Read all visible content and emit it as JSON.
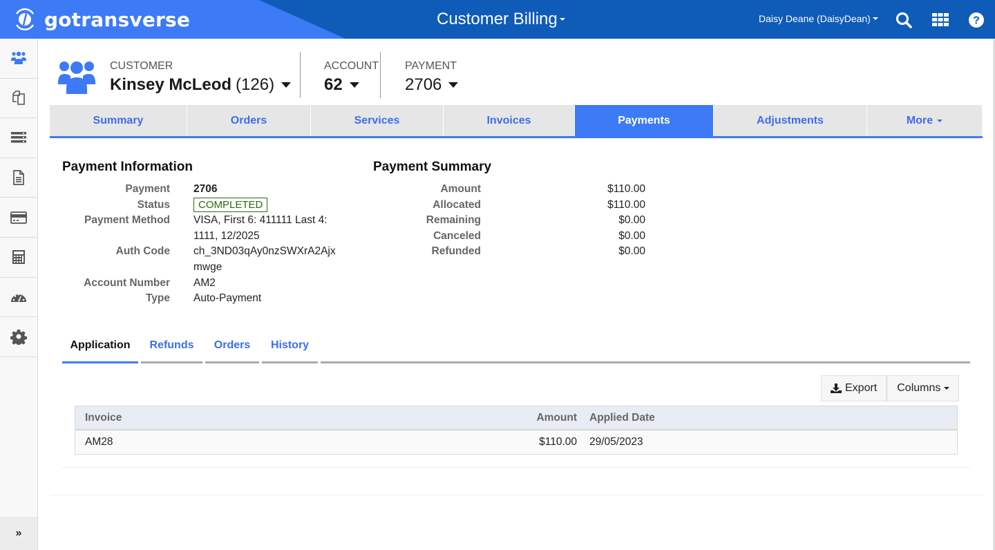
{
  "topbar": {
    "brand": "gotransverse",
    "app_title": "Customer Billing",
    "user": "Daisy Deane (DaisyDean)",
    "icons": [
      "search-icon",
      "apps-grid-icon",
      "help-icon"
    ],
    "colors": {
      "bar": "#0f5bb8",
      "brand_bg": "#3d7af5"
    }
  },
  "sidebar": {
    "items": [
      {
        "icon": "customers-icon",
        "active": true
      },
      {
        "icon": "documents-icon",
        "active": false
      },
      {
        "icon": "services-list-icon",
        "active": false
      },
      {
        "icon": "invoice-icon",
        "active": false
      },
      {
        "icon": "credit-card-icon",
        "active": false
      },
      {
        "icon": "calculator-icon",
        "active": false
      },
      {
        "icon": "dashboard-gauge-icon",
        "active": false
      },
      {
        "icon": "settings-gear-icon",
        "active": false
      }
    ],
    "expand_label": "»"
  },
  "context": {
    "customer_label": "CUSTOMER",
    "customer_name": "Kinsey McLeod",
    "customer_id": "(126)",
    "account_label": "ACCOUNT",
    "account_value": "62",
    "payment_label": "PAYMENT",
    "payment_value": "2706"
  },
  "main_tabs": [
    {
      "label": "Summary",
      "active": false
    },
    {
      "label": "Orders",
      "active": false
    },
    {
      "label": "Services",
      "active": false
    },
    {
      "label": "Invoices",
      "active": false
    },
    {
      "label": "Payments",
      "active": true
    },
    {
      "label": "Adjustments",
      "active": false
    },
    {
      "label": "More",
      "active": false,
      "dropdown": true
    }
  ],
  "payment_information": {
    "title": "Payment Information",
    "fields": {
      "payment": {
        "label": "Payment",
        "value": "2706"
      },
      "status": {
        "label": "Status",
        "value": "COMPLETED"
      },
      "method": {
        "label": "Payment Method",
        "value_line1": "VISA, First 6: 411111 Last 4:",
        "value_line2": "1111, 12/2025"
      },
      "auth": {
        "label": "Auth Code",
        "value_line1": "ch_3ND03qAy0nzSWXrA2Ajx",
        "value_line2": "mwge"
      },
      "account_number": {
        "label": "Account Number",
        "value": "AM2"
      },
      "type": {
        "label": "Type",
        "value": "Auto-Payment"
      }
    },
    "status_color": "#2d6a12"
  },
  "payment_summary": {
    "title": "Payment Summary",
    "rows": [
      {
        "label": "Amount",
        "value": "$110.00"
      },
      {
        "label": "Allocated",
        "value": "$110.00"
      },
      {
        "label": "Remaining",
        "value": "$0.00"
      },
      {
        "label": "Canceled",
        "value": "$0.00"
      },
      {
        "label": "Refunded",
        "value": "$0.00"
      }
    ]
  },
  "sub_tabs": [
    {
      "label": "Application",
      "active": true
    },
    {
      "label": "Refunds",
      "active": false
    },
    {
      "label": "Orders",
      "active": false
    },
    {
      "label": "History",
      "active": false
    }
  ],
  "toolbar": {
    "export_label": "Export",
    "columns_label": "Columns"
  },
  "application_table": {
    "columns": [
      "Invoice",
      "Amount",
      "Applied Date"
    ],
    "rows": [
      {
        "invoice": "AM28",
        "amount": "$110.00",
        "applied_date": "29/05/2023"
      }
    ]
  }
}
